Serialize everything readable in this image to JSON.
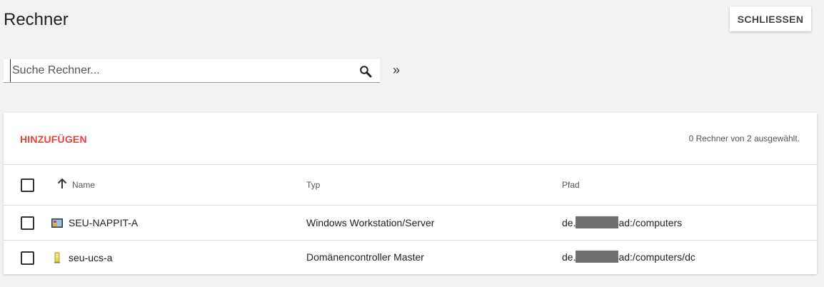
{
  "page": {
    "title": "Rechner",
    "close_label": "SCHLIESSEN"
  },
  "search": {
    "placeholder": "Suche Rechner...",
    "value": "",
    "more_label": "»"
  },
  "card": {
    "add_label": "HINZUFÜGEN",
    "selection_status": "0 Rechner von 2 ausgewählt.",
    "columns": [
      "Name",
      "Typ",
      "Pfad"
    ],
    "rows": [
      {
        "name": "SEU-NAPPIT-A",
        "icon": "windows-computer-icon",
        "type": "Windows Workstation/Server",
        "path_prefix": "de.",
        "path_suffix": "ad:/computers"
      },
      {
        "name": "seu-ucs-a",
        "icon": "domain-controller-icon",
        "type": "Domänencontroller Master",
        "path_prefix": "de.",
        "path_suffix": "ad:/computers/dc"
      }
    ]
  },
  "colors": {
    "accent": "#e8413a",
    "background": "#f2f2f2"
  }
}
